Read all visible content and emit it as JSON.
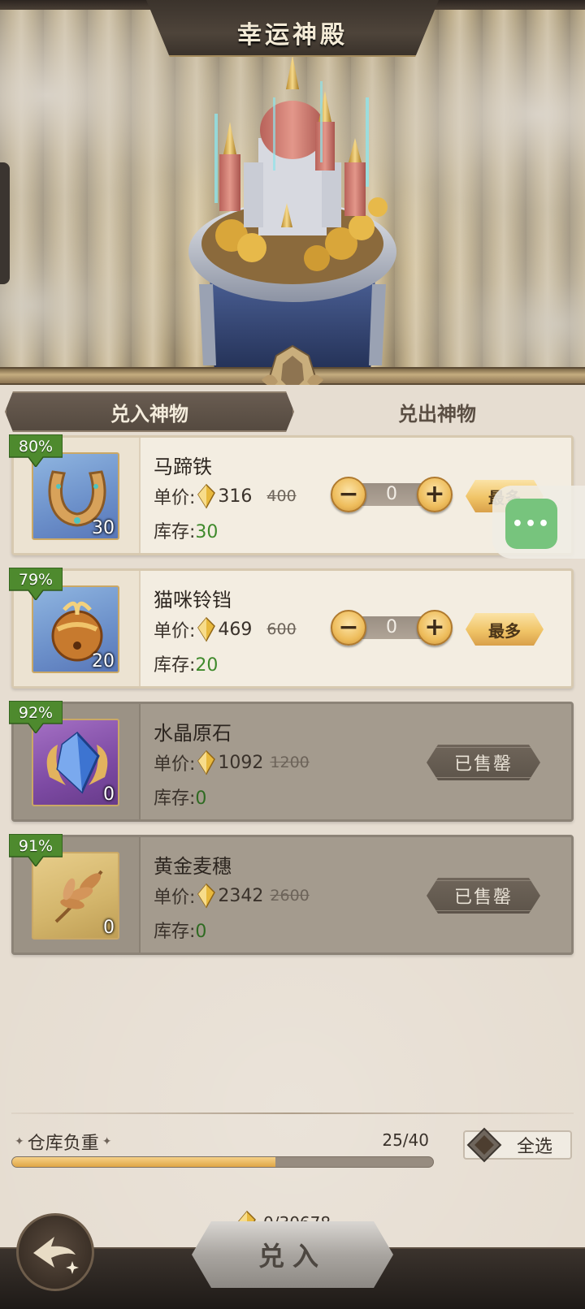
{
  "header": {
    "title": "幸运神殿"
  },
  "tabs": [
    {
      "label": "兑入神物",
      "active": true
    },
    {
      "label": "兑出神物",
      "active": false
    }
  ],
  "labels": {
    "unit_price": "单价:",
    "stock": "库存:",
    "max_button": "最多",
    "sold_out": "已售罄"
  },
  "items": [
    {
      "discount": "80%",
      "name": "马蹄铁",
      "qty": "30",
      "price": "316",
      "old_price": "400",
      "stock": "30",
      "count": "0",
      "status": "available",
      "icon": "horseshoe-icon"
    },
    {
      "discount": "79%",
      "name": "猫咪铃铛",
      "qty": "20",
      "price": "469",
      "old_price": "600",
      "stock": "20",
      "count": "0",
      "status": "available",
      "icon": "bell-icon"
    },
    {
      "discount": "92%",
      "name": "水晶原石",
      "qty": "0",
      "price": "1092",
      "old_price": "1200",
      "stock": "0",
      "status": "sold_out",
      "icon": "crystal-icon"
    },
    {
      "discount": "91%",
      "name": "黄金麦穗",
      "qty": "0",
      "price": "2342",
      "old_price": "2600",
      "stock": "0",
      "status": "sold_out",
      "icon": "wheat-icon"
    }
  ],
  "warehouse": {
    "label": "仓库负重",
    "count": "25/40",
    "fill_fraction": 0.625
  },
  "select_all": "全选",
  "total": "0/30678",
  "confirm_button": "兑入",
  "floating_button": "•••",
  "colors": {
    "accent_gold": "#eebd5c",
    "stock_green": "#3f8a2c",
    "discount_green": "#4e8a2e",
    "panel_bg": "#e6ddd1"
  }
}
